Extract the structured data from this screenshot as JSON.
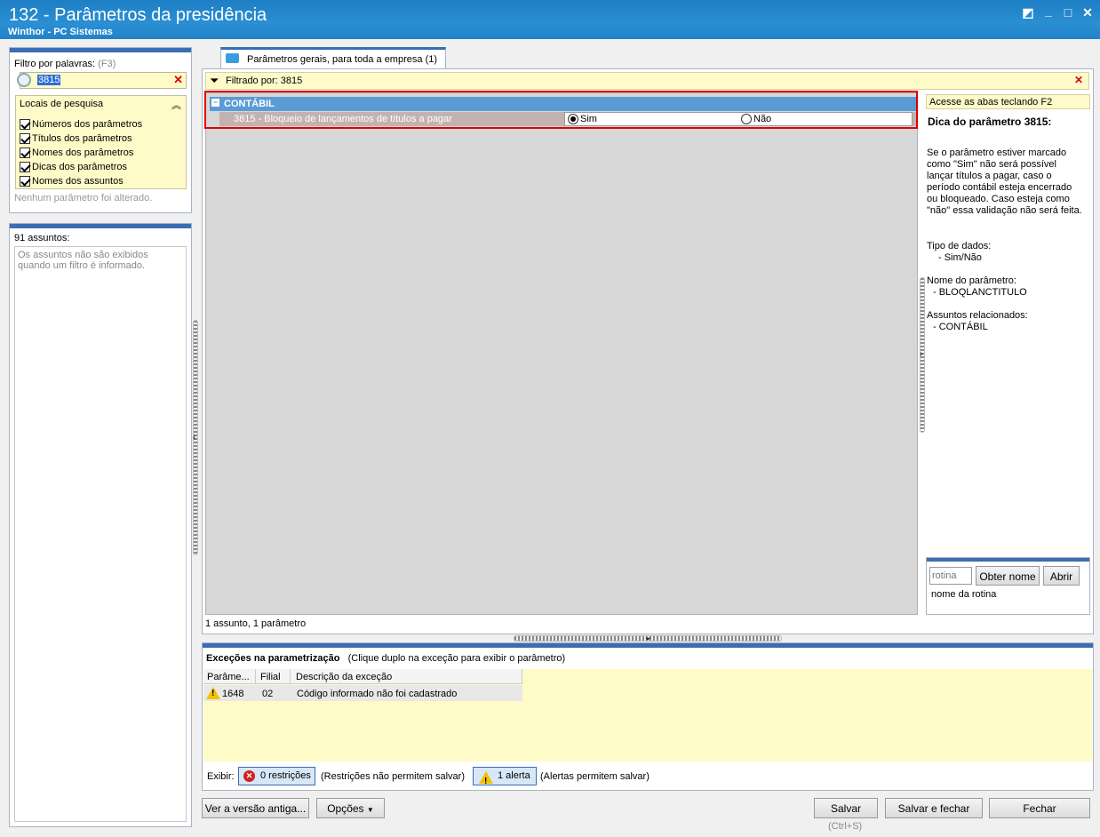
{
  "window": {
    "title": "132 - Parâmetros da presidência",
    "subtitle": "Winthor - PC Sistemas"
  },
  "left": {
    "filter_label": "Filtro por palavras:",
    "filter_hint": "(F3)",
    "filter_value": "3815",
    "search_places_title": "Locais de pesquisa",
    "checkboxes": [
      {
        "label": "Números dos parâmetros",
        "checked": true
      },
      {
        "label": "Títulos dos parâmetros",
        "checked": true
      },
      {
        "label": "Nomes dos parâmetros",
        "checked": true
      },
      {
        "label": "Dicas dos parâmetros",
        "checked": true
      },
      {
        "label": "Nomes dos assuntos",
        "checked": true
      }
    ],
    "no_change_text": "Nenhum parâmetro foi alterado.",
    "subjects_count": "91 assuntos:",
    "subjects_hint": "Os assuntos não são exibidos quando um filtro é informado."
  },
  "tab": {
    "label": "Parâmetros gerais, para toda a empresa",
    "count": "(1)"
  },
  "filter_bar": {
    "label": "Filtrado por: 3815"
  },
  "group": {
    "name": "CONTÁBIL",
    "collapse": "−"
  },
  "param": {
    "label": "3815 - Bloqueio de lançamentos de títulos a pagar",
    "option_yes": "Sim",
    "option_no": "Não",
    "selected": "Sim"
  },
  "status_text": "1 assunto, 1 parâmetro",
  "tip": {
    "f2_hint": "Acesse as abas teclando F2",
    "title": "Dica do parâmetro 3815:",
    "body": "Se o parâmetro estiver marcado como \"Sim\" não será possível lançar títulos a pagar, caso o período contábil esteja encerrado ou bloqueado. Caso esteja como \"não\" essa validação não será feita.",
    "type_label": "Tipo de dados:",
    "type_value": "- Sim/Não",
    "name_label": "Nome do parâmetro:",
    "name_value": "- BLOQLANCTITULO",
    "subjects_label": "Assuntos relacionados:",
    "subjects_value": "- CONTÁBIL"
  },
  "routine": {
    "placeholder": "rotina",
    "get_name": "Obter nome",
    "open": "Abrir",
    "name_label": "nome da rotina"
  },
  "exceptions": {
    "title": "Exceções na parametrização",
    "hint": "(Clique duplo na exceção para exibir o parâmetro)",
    "columns": [
      "Parâme...",
      "Filial",
      "Descrição da exceção"
    ],
    "rows": [
      {
        "param": "1648",
        "filial": "02",
        "desc": "Código informado não foi cadastrado"
      }
    ],
    "show_label": "Exibir:",
    "restrictions_btn": "0 restrições",
    "restrictions_note": "(Restrições não permitem salvar)",
    "alerts_btn": "1 alerta",
    "alerts_note": "(Alertas permitem salvar)"
  },
  "footer": {
    "old_version": "Ver a versão antiga...",
    "options": "Opções",
    "save": "Salvar",
    "save_shortcut": "(Ctrl+S)",
    "save_close": "Salvar e fechar",
    "close": "Fechar"
  },
  "colors": {
    "title_bar": "#2282c8",
    "group_header": "#5b9bd5",
    "highlight": "#e00000",
    "yellow_panel": "#fffbc9"
  }
}
